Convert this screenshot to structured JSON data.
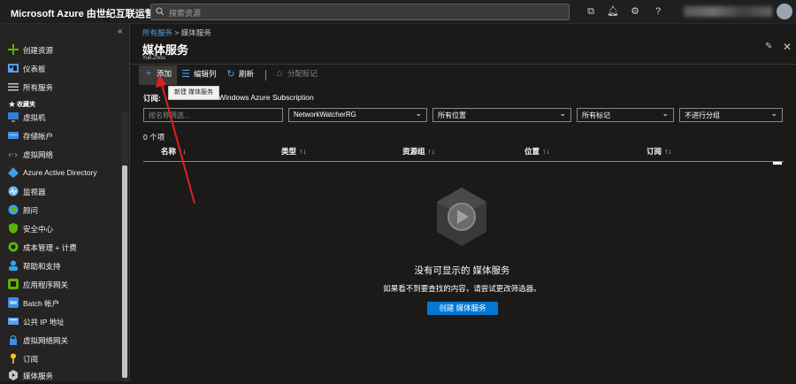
{
  "topbar": {
    "brand": "Microsoft Azure 由世纪互联运营",
    "search_placeholder": "搜索资源",
    "icons": [
      "cloud-shell-icon",
      "bell-icon",
      "gear-icon",
      "help-icon"
    ]
  },
  "sidebar": {
    "collapse_label": "«",
    "top_items": [
      {
        "label": "创建资源",
        "icon": "plus-icon",
        "color": "#5db300"
      },
      {
        "label": "仪表板",
        "icon": "dashboard-icon",
        "color": "#5ea0ef"
      },
      {
        "label": "所有服务",
        "icon": "list-icon",
        "color": "#c8c6c4"
      }
    ],
    "favorites_header": "收藏夹",
    "favorites": [
      {
        "label": "虚拟机",
        "icon": "vm-icon",
        "color": "#2f7fd8"
      },
      {
        "label": "存储帐户",
        "icon": "storage-icon",
        "color": "#3a8ee6"
      },
      {
        "label": "虚拟网络",
        "icon": "vnet-icon",
        "color": "#5fb3ef"
      },
      {
        "label": "Azure Active Directory",
        "icon": "aad-icon",
        "color": "#3a9fe6"
      },
      {
        "label": "监视器",
        "icon": "monitor-icon",
        "color": "#6ab7f0"
      },
      {
        "label": "顾问",
        "icon": "advisor-icon",
        "color": "#3aa3e6"
      },
      {
        "label": "安全中心",
        "icon": "security-icon",
        "color": "#5db300"
      },
      {
        "label": "成本管理 + 计费",
        "icon": "cost-icon",
        "color": "#5db300"
      },
      {
        "label": "帮助和支持",
        "icon": "support-icon",
        "color": "#3a9fe6"
      },
      {
        "label": "应用程序网关",
        "icon": "appgw-icon",
        "color": "#5db300"
      },
      {
        "label": "Batch 帐户",
        "icon": "batch-icon",
        "color": "#3a8ee6"
      },
      {
        "label": "公共 IP 地址",
        "icon": "public-ip-icon",
        "color": "#5ea0ef"
      },
      {
        "label": "虚拟网络网关",
        "icon": "vnet-gateway-icon",
        "color": "#3a8ee6"
      },
      {
        "label": "订阅",
        "icon": "key-icon",
        "color": "#f2c811"
      },
      {
        "label": "媒体服务",
        "icon": "media-icon",
        "color": "#c8c6c4"
      }
    ]
  },
  "breadcrumb": {
    "link": "所有服务",
    "separator": ">",
    "current": "媒体服务"
  },
  "page": {
    "title": "媒体服务",
    "subtitle": "Yue.Zhou"
  },
  "toolbar": {
    "add": "添加",
    "edit_columns": "编辑列",
    "refresh": "刷新",
    "assign_tags": "分配标记",
    "tooltip": "新建 媒体服务"
  },
  "subscription": {
    "label": "订阅:",
    "value": "Windows Azure Subscription"
  },
  "filters": {
    "name_placeholder": "按名称筛选...",
    "resource_group": "NetworkWatcherRG",
    "location": "所有位置",
    "tags": "所有标记",
    "grouping": "不进行分组"
  },
  "list": {
    "count": "0 个项",
    "columns": [
      "名称",
      "类型",
      "资源组",
      "位置",
      "订阅"
    ],
    "sort_glyph": "↑↓"
  },
  "empty": {
    "title": "没有可显示的 媒体服务",
    "description": "如果看不到要查找的内容，请尝试更改筛选器。",
    "create_button": "创建 媒体服务"
  },
  "colors": {
    "accent": "#0078d4",
    "link": "#4f9fe6",
    "annotation_arrow": "#e02020"
  }
}
